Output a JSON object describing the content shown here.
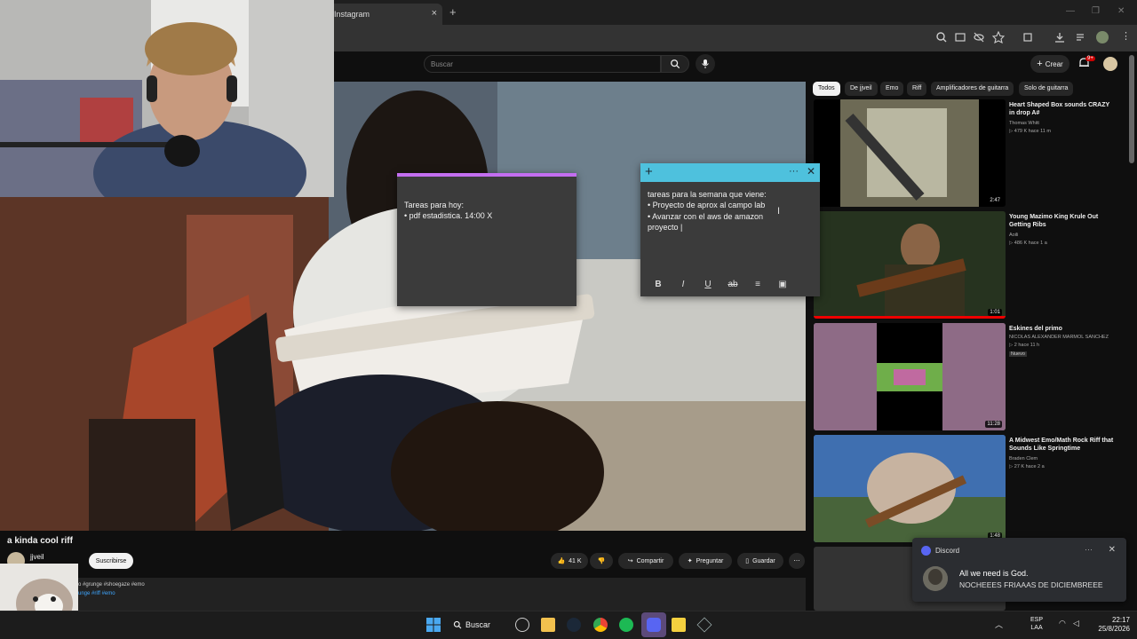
{
  "browser": {
    "tab_title": "Instagram",
    "tab_close": "×",
    "new_tab": "+",
    "window_controls": [
      "—",
      "❐",
      "✕"
    ]
  },
  "youtube": {
    "search_placeholder": "Buscar",
    "create_label": "Crear",
    "notifications_badge": "9+",
    "chips": [
      "Todos",
      "De jjveil",
      "Emo",
      "Riff",
      "Amplificadores de guitarra",
      "Solo de guitarra"
    ],
    "video": {
      "title": "a kinda cool riff",
      "channel": "jjveil",
      "subscribe": "Suscribirse",
      "likes": "41 K",
      "share": "Compartir",
      "ask": "Preguntar",
      "save": "Guardar",
      "more": "⋯",
      "tags_line1": "o #grunge #shoegaze #emo",
      "tags_line2": "unge #riff #emo"
    },
    "recommendations": [
      {
        "title": "Heart Shaped Box sounds CRAZY in drop A#",
        "channel": "Thomas Whitt",
        "stats": "▷ 479 K  hace 11 m",
        "duration": "2:47"
      },
      {
        "title": "Young Mazimo King Krule Out Getting Ribs",
        "channel": "Aoili",
        "stats": "▷ 486 K  hace 1 a",
        "duration": "1:01"
      },
      {
        "title": "Eskines del primo",
        "channel": "NICOLAS ALEXANDER MARMOL SANCHEZ",
        "stats": "▷ 2  hace 11 h",
        "badge": "Nuevo",
        "duration": "11:28"
      },
      {
        "title": "A Midwest Emo/Math Rock Riff that Sounds Like Springtime",
        "channel": "Braden Clem",
        "stats": "▷ 27 K  hace 2 a",
        "duration": "1:48"
      }
    ]
  },
  "notes": {
    "note1": {
      "line1": "Tareas para hoy:",
      "line2": "• pdf estadistica. 14:00 X"
    },
    "note2": {
      "plus": "+",
      "menu": "···",
      "close": "✕",
      "line1": "tareas para la semana que viene:",
      "line2": "• Proyecto de aprox al campo lab",
      "line3": "• Avanzar con el aws de amazon",
      "line4": "proyecto |",
      "toolbar": [
        "B",
        "I",
        "U",
        "ab",
        "≡",
        "▣"
      ]
    }
  },
  "discord": {
    "app": "Discord",
    "dots": "···",
    "close": "✕",
    "line1": "All we need is God.",
    "line2": "NOCHEEES FRIAAAS DE DICIEMBREEE"
  },
  "taskbar": {
    "search_label": "Buscar",
    "lang_1": "ESP",
    "lang_2": "LAA",
    "time": "22:17",
    "date": "25/8/2026"
  },
  "colors": {
    "yt_bg": "#0f0f0f",
    "note_purple_accent": "#c36ef0",
    "note_cyan_header": "#4ec1dd",
    "discord_blurple": "#5865f2"
  }
}
